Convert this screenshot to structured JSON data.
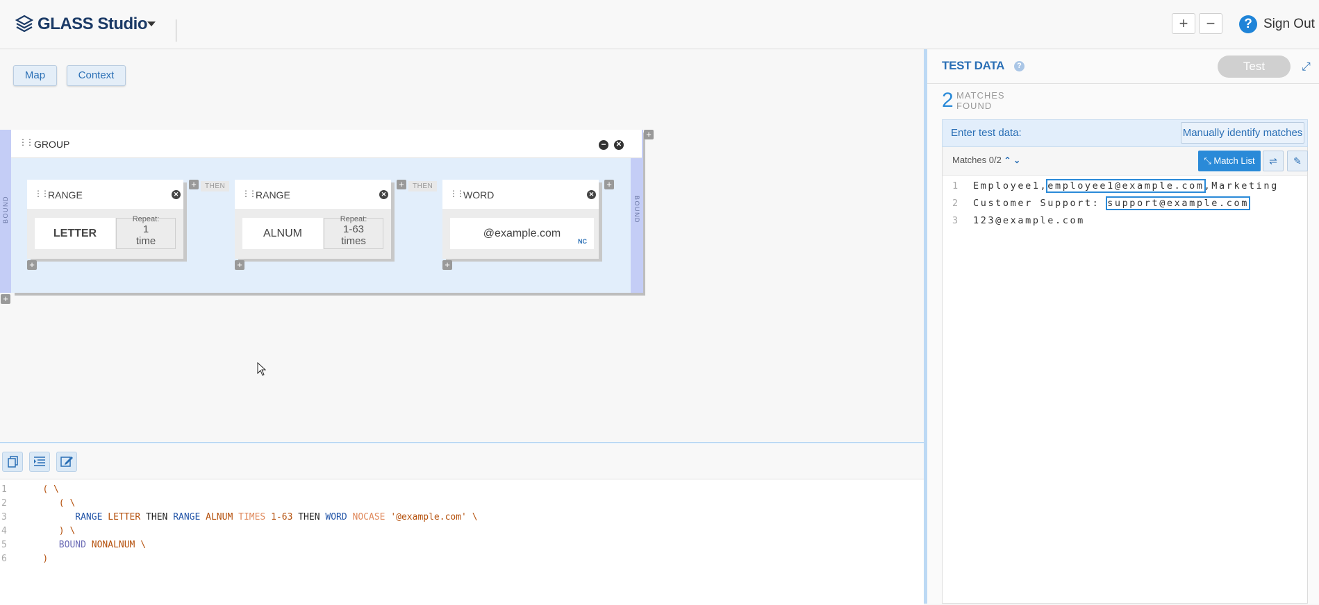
{
  "header": {
    "app_name": "GLASS Studio",
    "zoom_in": "+",
    "zoom_out": "−",
    "help": "?",
    "sign_out": "Sign Out"
  },
  "canvas": {
    "tabs": [
      {
        "label": "Map"
      },
      {
        "label": "Context"
      }
    ],
    "group": {
      "title": "GROUP",
      "bound_left": "BOUND",
      "bound_right": "BOUND",
      "then_label": "THEN",
      "nodes": [
        {
          "title": "RANGE",
          "value": "LETTER",
          "repeat_label": "Repeat:",
          "repeat_value": "1",
          "repeat_unit": "time"
        },
        {
          "title": "RANGE",
          "value": "ALNUM",
          "repeat_label": "Repeat:",
          "repeat_value": "1-63",
          "repeat_unit": "times"
        },
        {
          "title": "WORD",
          "value": "@example.com",
          "flag": "NC"
        }
      ]
    }
  },
  "code": {
    "lines": [
      "1",
      "2",
      "3",
      "4",
      "5",
      "6"
    ],
    "tokens": {
      "open": "(",
      "backslash": "\\",
      "range": "RANGE",
      "letter": "LETTER",
      "then": "THEN",
      "alnum": "ALNUM",
      "times": "TIMES",
      "times_val": "1-63",
      "word": "WORD",
      "nocase": "NOCASE",
      "literal": "'@example.com'",
      "close": ")",
      "bound": "BOUND",
      "nonalnum": "NONALNUM"
    }
  },
  "test_data": {
    "title": "TEST DATA",
    "help": "?",
    "test_button": "Test",
    "match_count": "2",
    "match_label_1": "MATCHES",
    "match_label_2": "FOUND",
    "enter_label": "Enter test data:",
    "manual_button": "Manually identify matches",
    "matches_nav": "Matches 0/2",
    "match_list_button": "Match List",
    "lines": [
      {
        "num": "1",
        "pre": "Employee1,",
        "match": "employee1@example.com",
        "post": ",Marketing"
      },
      {
        "num": "2",
        "pre": "Customer Support: ",
        "match": "support@example.com",
        "post": ""
      },
      {
        "num": "3",
        "pre": "123@example.com",
        "match": "",
        "post": ""
      }
    ]
  },
  "colors": {
    "accent": "#2a8ad8",
    "brand": "#1b3a66",
    "group_bg": "#e2eefb",
    "bound_bg": "#c4cdf6"
  }
}
